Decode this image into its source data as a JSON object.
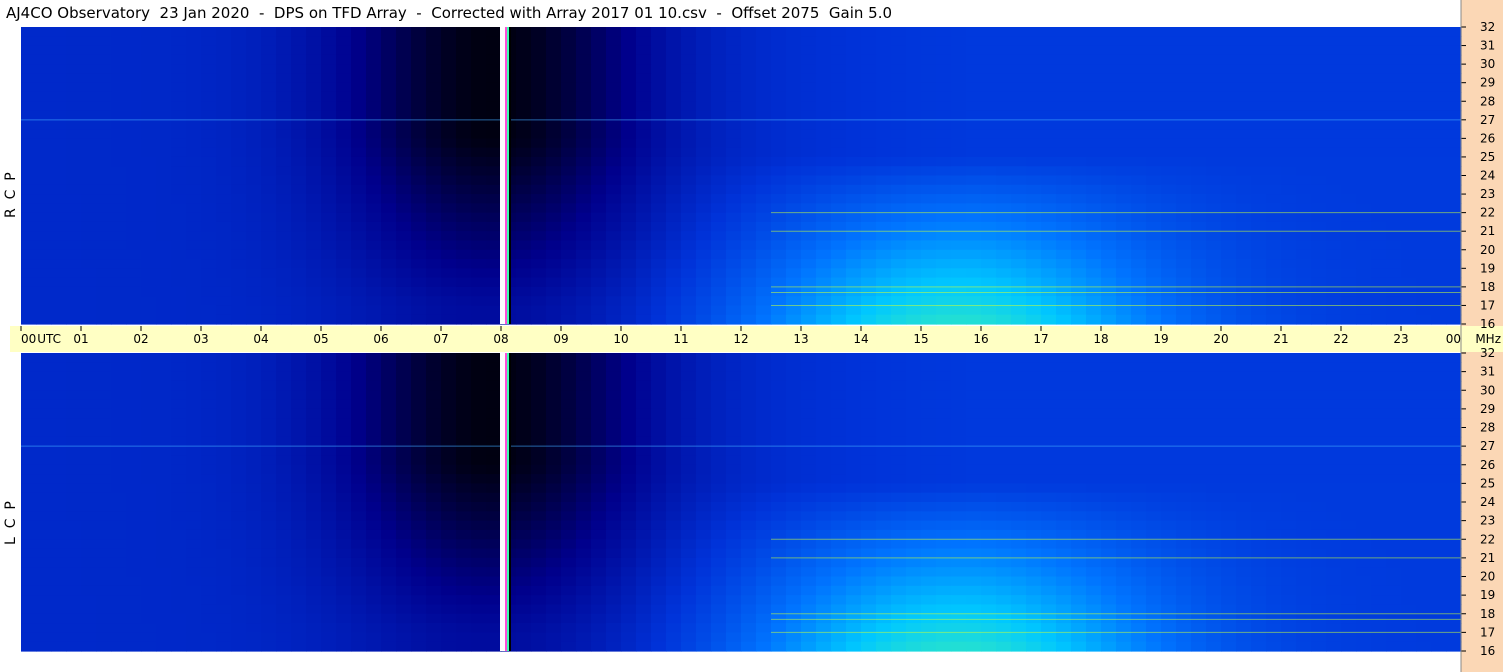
{
  "title": "AJ4CO Observatory  23 Jan 2020  -  DPS on TFD Array  -  Corrected with Array 2017 01 10.csv  -  Offset 2075  Gain 5.0",
  "panels": [
    {
      "label": "R  C  P"
    },
    {
      "label": "L  C  P"
    }
  ],
  "colors": {
    "freq_scale_bg": "#fbd7b5",
    "time_scale_bg": "#ffffc4",
    "colormap": [
      "#000000",
      "#00008c",
      "#0033d9",
      "#0074ff",
      "#00c8ff",
      "#3ff2b0",
      "#d8ff2b",
      "#ff2fd0"
    ]
  },
  "chart_data": {
    "type": "heatmap",
    "x_axis": {
      "label": "UTC",
      "ticks": [
        "00",
        "01",
        "02",
        "03",
        "04",
        "05",
        "06",
        "07",
        "08",
        "09",
        "10",
        "11",
        "12",
        "13",
        "14",
        "15",
        "16",
        "17",
        "18",
        "19",
        "20",
        "21",
        "22",
        "23",
        "00"
      ]
    },
    "y_axis": {
      "unit": "MHz",
      "range": [
        16,
        32
      ],
      "ticks": [
        16,
        17,
        18,
        19,
        20,
        21,
        22,
        23,
        24,
        25,
        26,
        27,
        28,
        29,
        30,
        31,
        32
      ]
    },
    "data_gap_utc": 8.1,
    "dark_regions_utc": [
      [
        4.5,
        11.2
      ]
    ],
    "bright_band_utc": [
      12.5,
      22
    ],
    "bright_band_mhz": [
      16,
      22
    ],
    "interference_lines_mhz": [
      17,
      17.7,
      18,
      21,
      22,
      27
    ]
  }
}
